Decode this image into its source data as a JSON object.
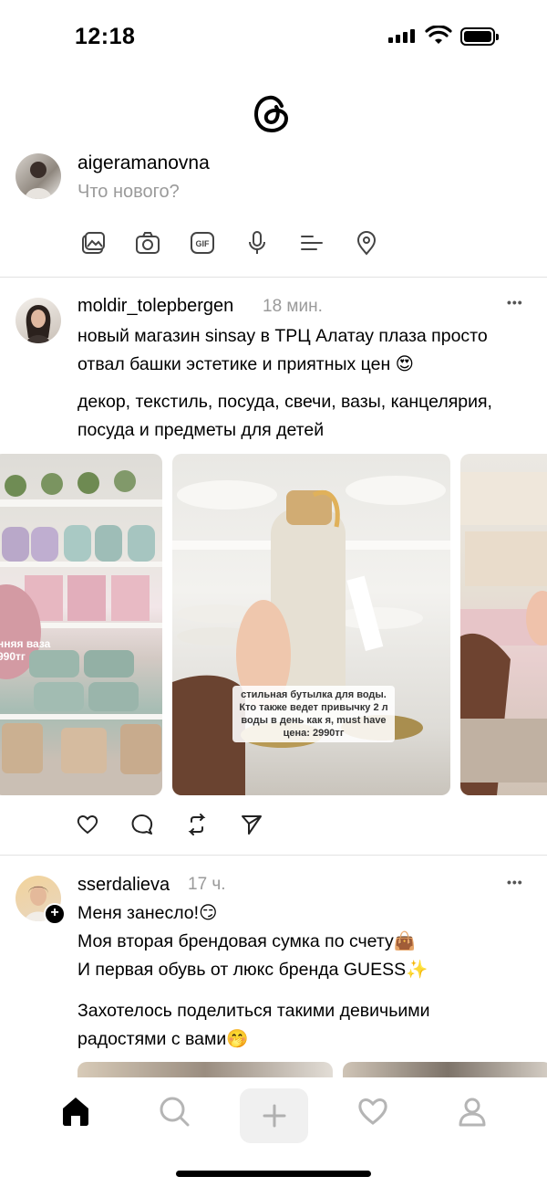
{
  "status_bar": {
    "time": "12:18"
  },
  "composer": {
    "username": "aigeramanovna",
    "placeholder": "Что нового?",
    "tools": [
      "gallery-icon",
      "camera-icon",
      "gif-icon",
      "mic-icon",
      "list-icon",
      "location-icon"
    ]
  },
  "posts": [
    {
      "username": "moldir_tolepbergen",
      "time": "18 мин.",
      "more": "•••",
      "paragraphs": [
        "новый магазин sinsay в ТРЦ Алатау плаза просто отвал башки эстетике и приятных цен 😍",
        "декор, текстиль, посуда, свечи, вазы, канцелярия, посуда и предметы для детей"
      ],
      "media": [
        {
          "caption": "нняя ваза\n990тг"
        },
        {
          "caption": "стильная бутылка для воды. Кто также ведет привычку 2 л воды в день как я, must have\nцена: 2990тг"
        },
        {
          "caption": ""
        }
      ]
    },
    {
      "username": "sserdalieva",
      "time": "17 ч.",
      "more": "•••",
      "paragraphs": [
        "Меня занесло!😏",
        "Моя вторая брендовая сумка по счету👜",
        "И первая обувь от люкс бренда GUESS✨",
        "Захотелось поделиться такими девичьими радостями с вами🤭"
      ]
    }
  ],
  "tab_bar": {
    "tabs": [
      "home-icon",
      "search-icon",
      "new-post-icon",
      "activity-icon",
      "profile-icon"
    ]
  }
}
